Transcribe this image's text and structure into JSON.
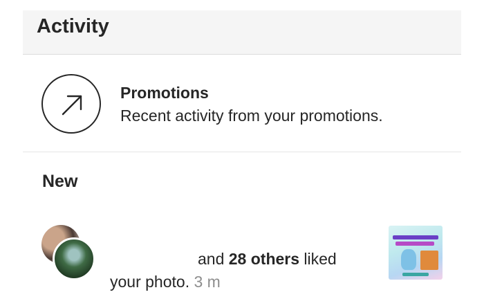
{
  "header": {
    "title": "Activity"
  },
  "promotions": {
    "title": "Promotions",
    "subtitle": "Recent activity from your promotions.",
    "icon": "arrow-up-right-icon"
  },
  "section_new": {
    "label": "New"
  },
  "notification": {
    "pre_text": "and ",
    "others_count": "28 others",
    "action_text": " liked",
    "object_text": "your photo.",
    "timestamp": "3 m",
    "icons": {
      "avatar_back": "user-avatar",
      "avatar_front": "user-avatar",
      "thumbnail": "post-thumbnail"
    }
  }
}
